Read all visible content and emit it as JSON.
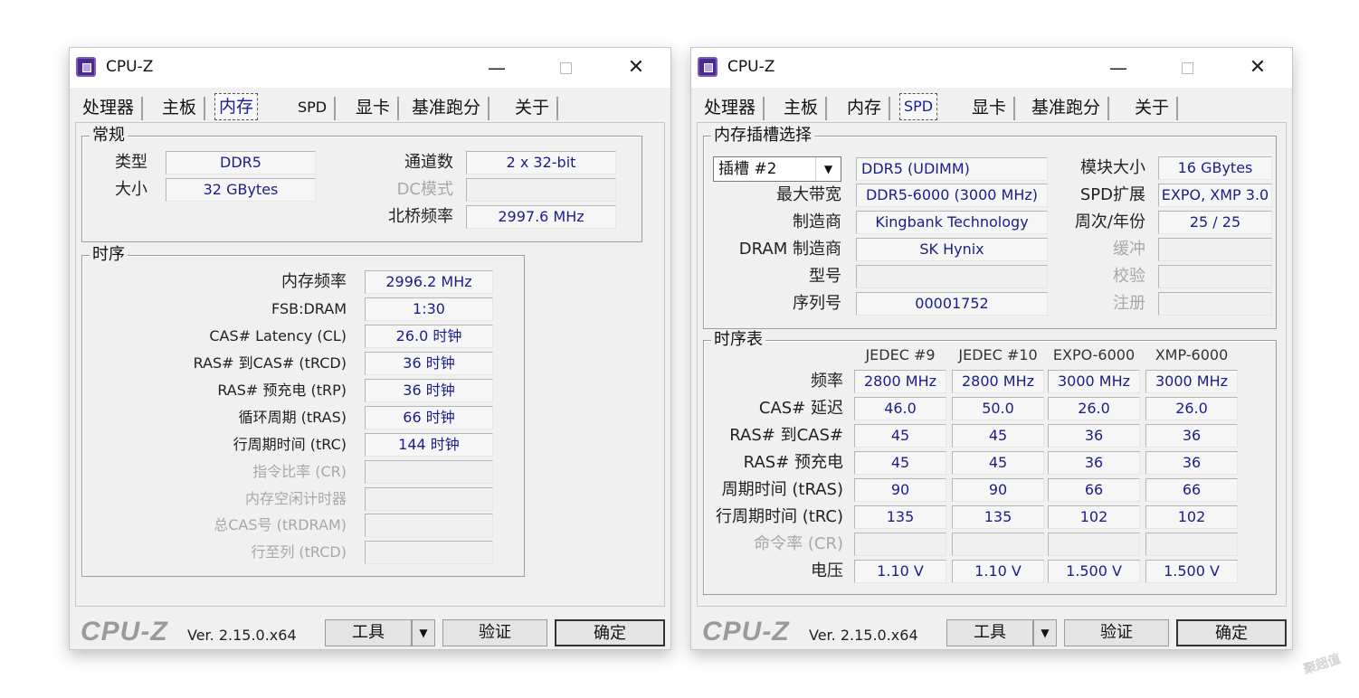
{
  "left": {
    "title": "CPU-Z",
    "tabs": [
      "处理器",
      "主板",
      "内存",
      "SPD",
      "显卡",
      "基准跑分",
      "关于"
    ],
    "general": {
      "label": "常规",
      "type_label": "类型",
      "type_value": "DDR5",
      "size_label": "大小",
      "size_value": "32 GBytes",
      "channels_label": "通道数",
      "channels_value": "2 x 32-bit",
      "dc_label": "DC模式",
      "dc_value": "",
      "nb_label": "北桥频率",
      "nb_value": "2997.6 MHz"
    },
    "timings": {
      "label": "时序",
      "rows": [
        {
          "label": "内存频率",
          "value": "2996.2 MHz"
        },
        {
          "label": "FSB:DRAM",
          "value": "1:30"
        },
        {
          "label": "CAS# Latency (CL)",
          "value": "26.0 时钟"
        },
        {
          "label": "RAS# 到CAS# (tRCD)",
          "value": "36 时钟"
        },
        {
          "label": "RAS# 预充电 (tRP)",
          "value": "36 时钟"
        },
        {
          "label": "循环周期 (tRAS)",
          "value": "66 时钟"
        },
        {
          "label": "行周期时间 (tRC)",
          "value": "144 时钟"
        },
        {
          "label": "指令比率 (CR)",
          "value": ""
        },
        {
          "label": "内存空闲计时器",
          "value": ""
        },
        {
          "label": "总CAS号 (tRDRAM)",
          "value": ""
        },
        {
          "label": "行至列 (tRCD)",
          "value": ""
        }
      ]
    },
    "footer": {
      "brand": "CPU-Z",
      "version": "Ver. 2.15.0.x64",
      "tools": "工具",
      "validate": "验证",
      "ok": "确定"
    }
  },
  "right": {
    "title": "CPU-Z",
    "tabs": [
      "处理器",
      "主板",
      "内存",
      "SPD",
      "显卡",
      "基准跑分",
      "关于"
    ],
    "slot": {
      "label": "内存插槽选择",
      "slot_select": "插槽 #2",
      "module_type": "DDR5 (UDIMM)",
      "max_bw_label": "最大带宽",
      "max_bw_value": "DDR5-6000 (3000 MHz)",
      "maker_label": "制造商",
      "maker_value": "Kingbank Technology",
      "dram_label": "DRAM 制造商",
      "dram_value": "SK Hynix",
      "model_label": "型号",
      "model_value": "",
      "serial_label": "序列号",
      "serial_value": "00001752",
      "size_label": "模块大小",
      "size_value": "16 GBytes",
      "spd_ext_label": "SPD扩展",
      "spd_ext_value": "EXPO, XMP 3.0",
      "week_label": "周次/年份",
      "week_value": "25 / 25",
      "buffer_label": "缓冲",
      "buffer_value": "",
      "check_label": "校验",
      "check_value": "",
      "reg_label": "注册",
      "reg_value": ""
    },
    "timing_table": {
      "label": "时序表",
      "columns": [
        "JEDEC #9",
        "JEDEC #10",
        "EXPO-6000",
        "XMP-6000"
      ],
      "rows": [
        {
          "label": "频率",
          "values": [
            "2800 MHz",
            "2800 MHz",
            "3000 MHz",
            "3000 MHz"
          ]
        },
        {
          "label": "CAS# 延迟",
          "values": [
            "46.0",
            "50.0",
            "26.0",
            "26.0"
          ]
        },
        {
          "label": "RAS# 到CAS#",
          "values": [
            "45",
            "45",
            "36",
            "36"
          ]
        },
        {
          "label": "RAS# 预充电",
          "values": [
            "45",
            "45",
            "36",
            "36"
          ]
        },
        {
          "label": "周期时间 (tRAS)",
          "values": [
            "90",
            "90",
            "66",
            "66"
          ]
        },
        {
          "label": "行周期时间 (tRC)",
          "values": [
            "135",
            "135",
            "102",
            "102"
          ]
        },
        {
          "label": "命令率 (CR)",
          "values": [
            "",
            "",
            "",
            ""
          ]
        },
        {
          "label": "电压",
          "values": [
            "1.10 V",
            "1.10 V",
            "1.500 V",
            "1.500 V"
          ]
        }
      ]
    },
    "footer": {
      "brand": "CPU-Z",
      "version": "Ver. 2.15.0.x64",
      "tools": "工具",
      "validate": "验证",
      "ok": "确定"
    }
  },
  "watermark": "聚超值"
}
